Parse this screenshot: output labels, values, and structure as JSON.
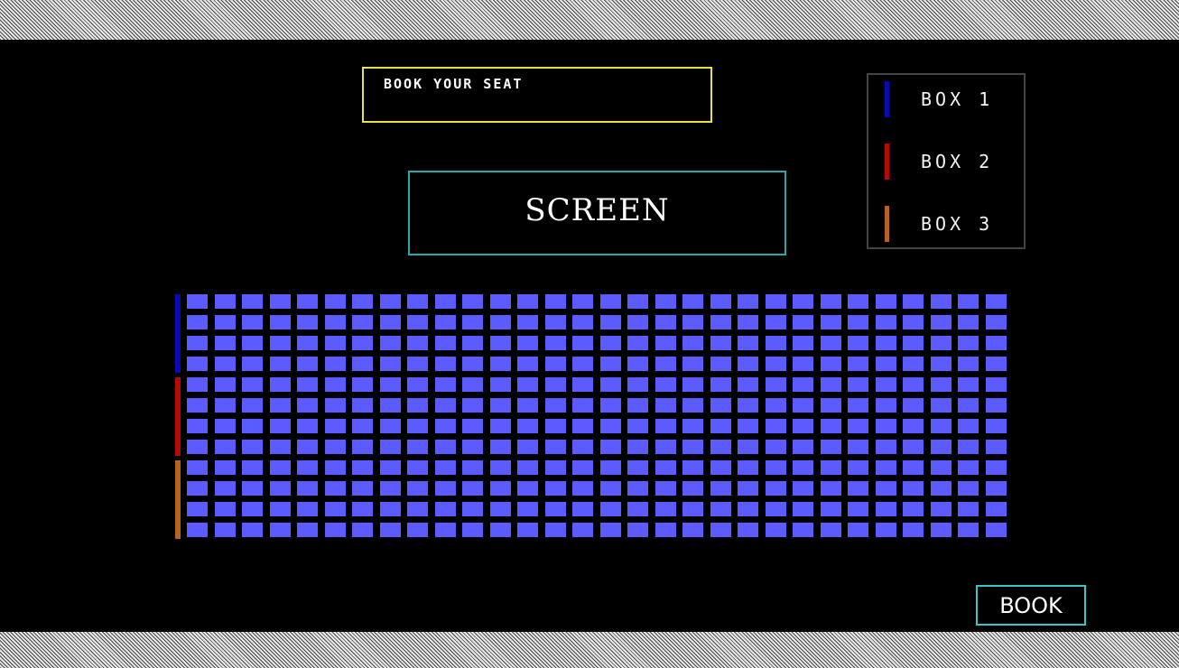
{
  "header": {
    "title": "BOOK YOUR SEAT"
  },
  "screen": {
    "label": "SCREEN"
  },
  "legend": {
    "items": [
      {
        "label": "BOX 1",
        "color": "#0a0ab4"
      },
      {
        "label": "BOX 2",
        "color": "#b40a0a"
      },
      {
        "label": "BOX 3",
        "color": "#b4641e"
      }
    ]
  },
  "seats": {
    "columns": 30,
    "boxes": [
      {
        "name": "BOX 1",
        "rows": 4,
        "color": "#0a0ab4"
      },
      {
        "name": "BOX 2",
        "rows": 4,
        "color": "#b40a0a"
      },
      {
        "name": "BOX 3",
        "rows": 4,
        "color": "#b4641e"
      }
    ],
    "seat_color": "#5b5bff"
  },
  "actions": {
    "book_label": "BOOK"
  }
}
